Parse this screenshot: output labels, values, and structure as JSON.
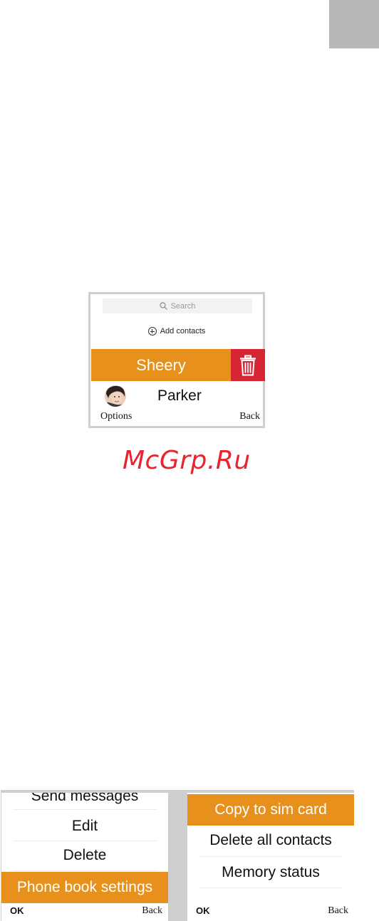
{
  "screen1": {
    "search_placeholder": "Search",
    "add_contacts_label": "Add contacts",
    "contacts": [
      {
        "name": "Sheery",
        "selected": true
      },
      {
        "name": "Parker",
        "selected": false
      }
    ],
    "softkey_left": "Options",
    "softkey_right": "Back",
    "accent_color": "#e8901c",
    "delete_color": "#d62634"
  },
  "watermark": "McGrp.Ru",
  "screen2": {
    "items": [
      "Send messages",
      "Edit",
      "Delete",
      "Phone book settings"
    ],
    "selected_index": 3,
    "softkey_left": "OK",
    "softkey_right": "Back"
  },
  "screen3": {
    "items": [
      "Copy to sim card",
      "Delete all contacts",
      "Memory status"
    ],
    "selected_index": 0,
    "softkey_left": "OK",
    "softkey_right": "Back"
  }
}
